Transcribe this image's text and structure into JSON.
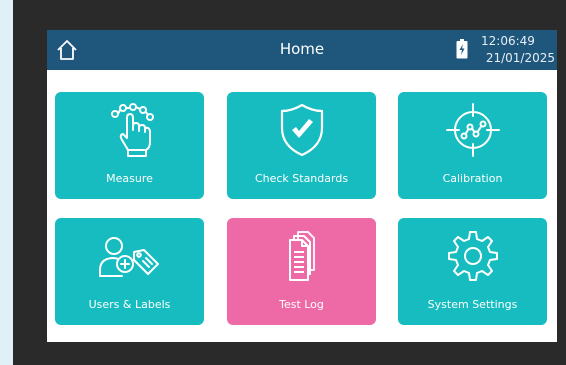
{
  "header": {
    "title": "Home",
    "time": "12:06:49",
    "date": "21/01/2025"
  },
  "tiles": [
    {
      "label": "Measure",
      "icon": "hand-tap-icon",
      "color": "#16bcbf"
    },
    {
      "label": "Check Standards",
      "icon": "shield-check-icon",
      "color": "#16bcbf"
    },
    {
      "label": "Calibration",
      "icon": "crosshair-graph-icon",
      "color": "#16bcbf"
    },
    {
      "label": "Users & Labels",
      "icon": "user-add-tag-icon",
      "color": "#16bcbf"
    },
    {
      "label": "Test Log",
      "icon": "documents-icon",
      "color": "#ee6aa6"
    },
    {
      "label": "System Settings",
      "icon": "gear-icon",
      "color": "#16bcbf"
    }
  ],
  "colors": {
    "header": "#1e567c",
    "tile": "#16bcbf",
    "tile_active": "#ee6aa6",
    "background": "#dff0f7",
    "bezel": "#2a2a2a"
  }
}
